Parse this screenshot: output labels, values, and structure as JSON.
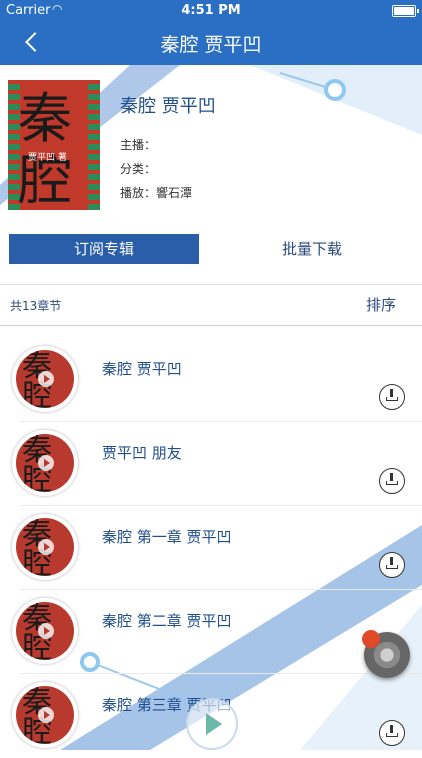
{
  "status_bar": {
    "carrier": "Carrier",
    "time": "4:51 PM"
  },
  "nav": {
    "title": "秦腔 贾平凹"
  },
  "album": {
    "title": "秦腔 贾平凹",
    "cover_glyphs": "秦腔",
    "cover_author": "贾平凹 著",
    "host_label": "主播：",
    "category_label": "分类：",
    "play_label": "播放：",
    "play_value": "響石潭"
  },
  "actions": {
    "subscribe": "订阅专辑",
    "batch_download": "批量下载"
  },
  "list_header": {
    "count": "共13章节",
    "sort": "排序"
  },
  "items": [
    {
      "title": "秦腔 贾平凹"
    },
    {
      "title": "贾平凹 朋友"
    },
    {
      "title": "秦腔 第一章 贾平凹"
    },
    {
      "title": "秦腔 第二章 贾平凹"
    },
    {
      "title": "秦腔 第三章 贾平凹"
    }
  ],
  "colors": {
    "nav": "#2a6fc4",
    "accent": "#2a5ea8",
    "text_blue": "#1f4e8c"
  }
}
